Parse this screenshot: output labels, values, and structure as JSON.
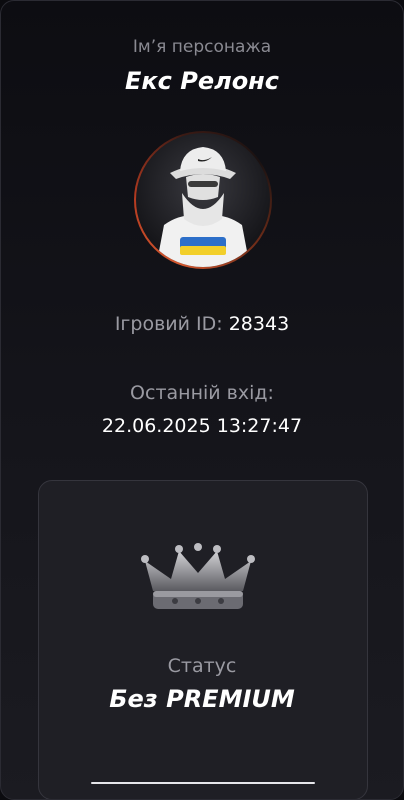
{
  "profile": {
    "name_label": "Ім’я персонажа",
    "name": "Екс Релонс",
    "avatar_icon": "avatar-image",
    "game_id_label": "Ігровий ID:",
    "game_id": "28343",
    "last_login_label": "Останній вхід:",
    "last_login": "22.06.2025 13:27:47"
  },
  "status": {
    "icon": "crown-icon",
    "label": "Статус",
    "value": "Без PREMIUM"
  },
  "colors": {
    "background": "#0b0b0f",
    "avatar_ring": "#d4582f",
    "text_primary": "#ffffff",
    "text_secondary": "#9a9aa2"
  }
}
